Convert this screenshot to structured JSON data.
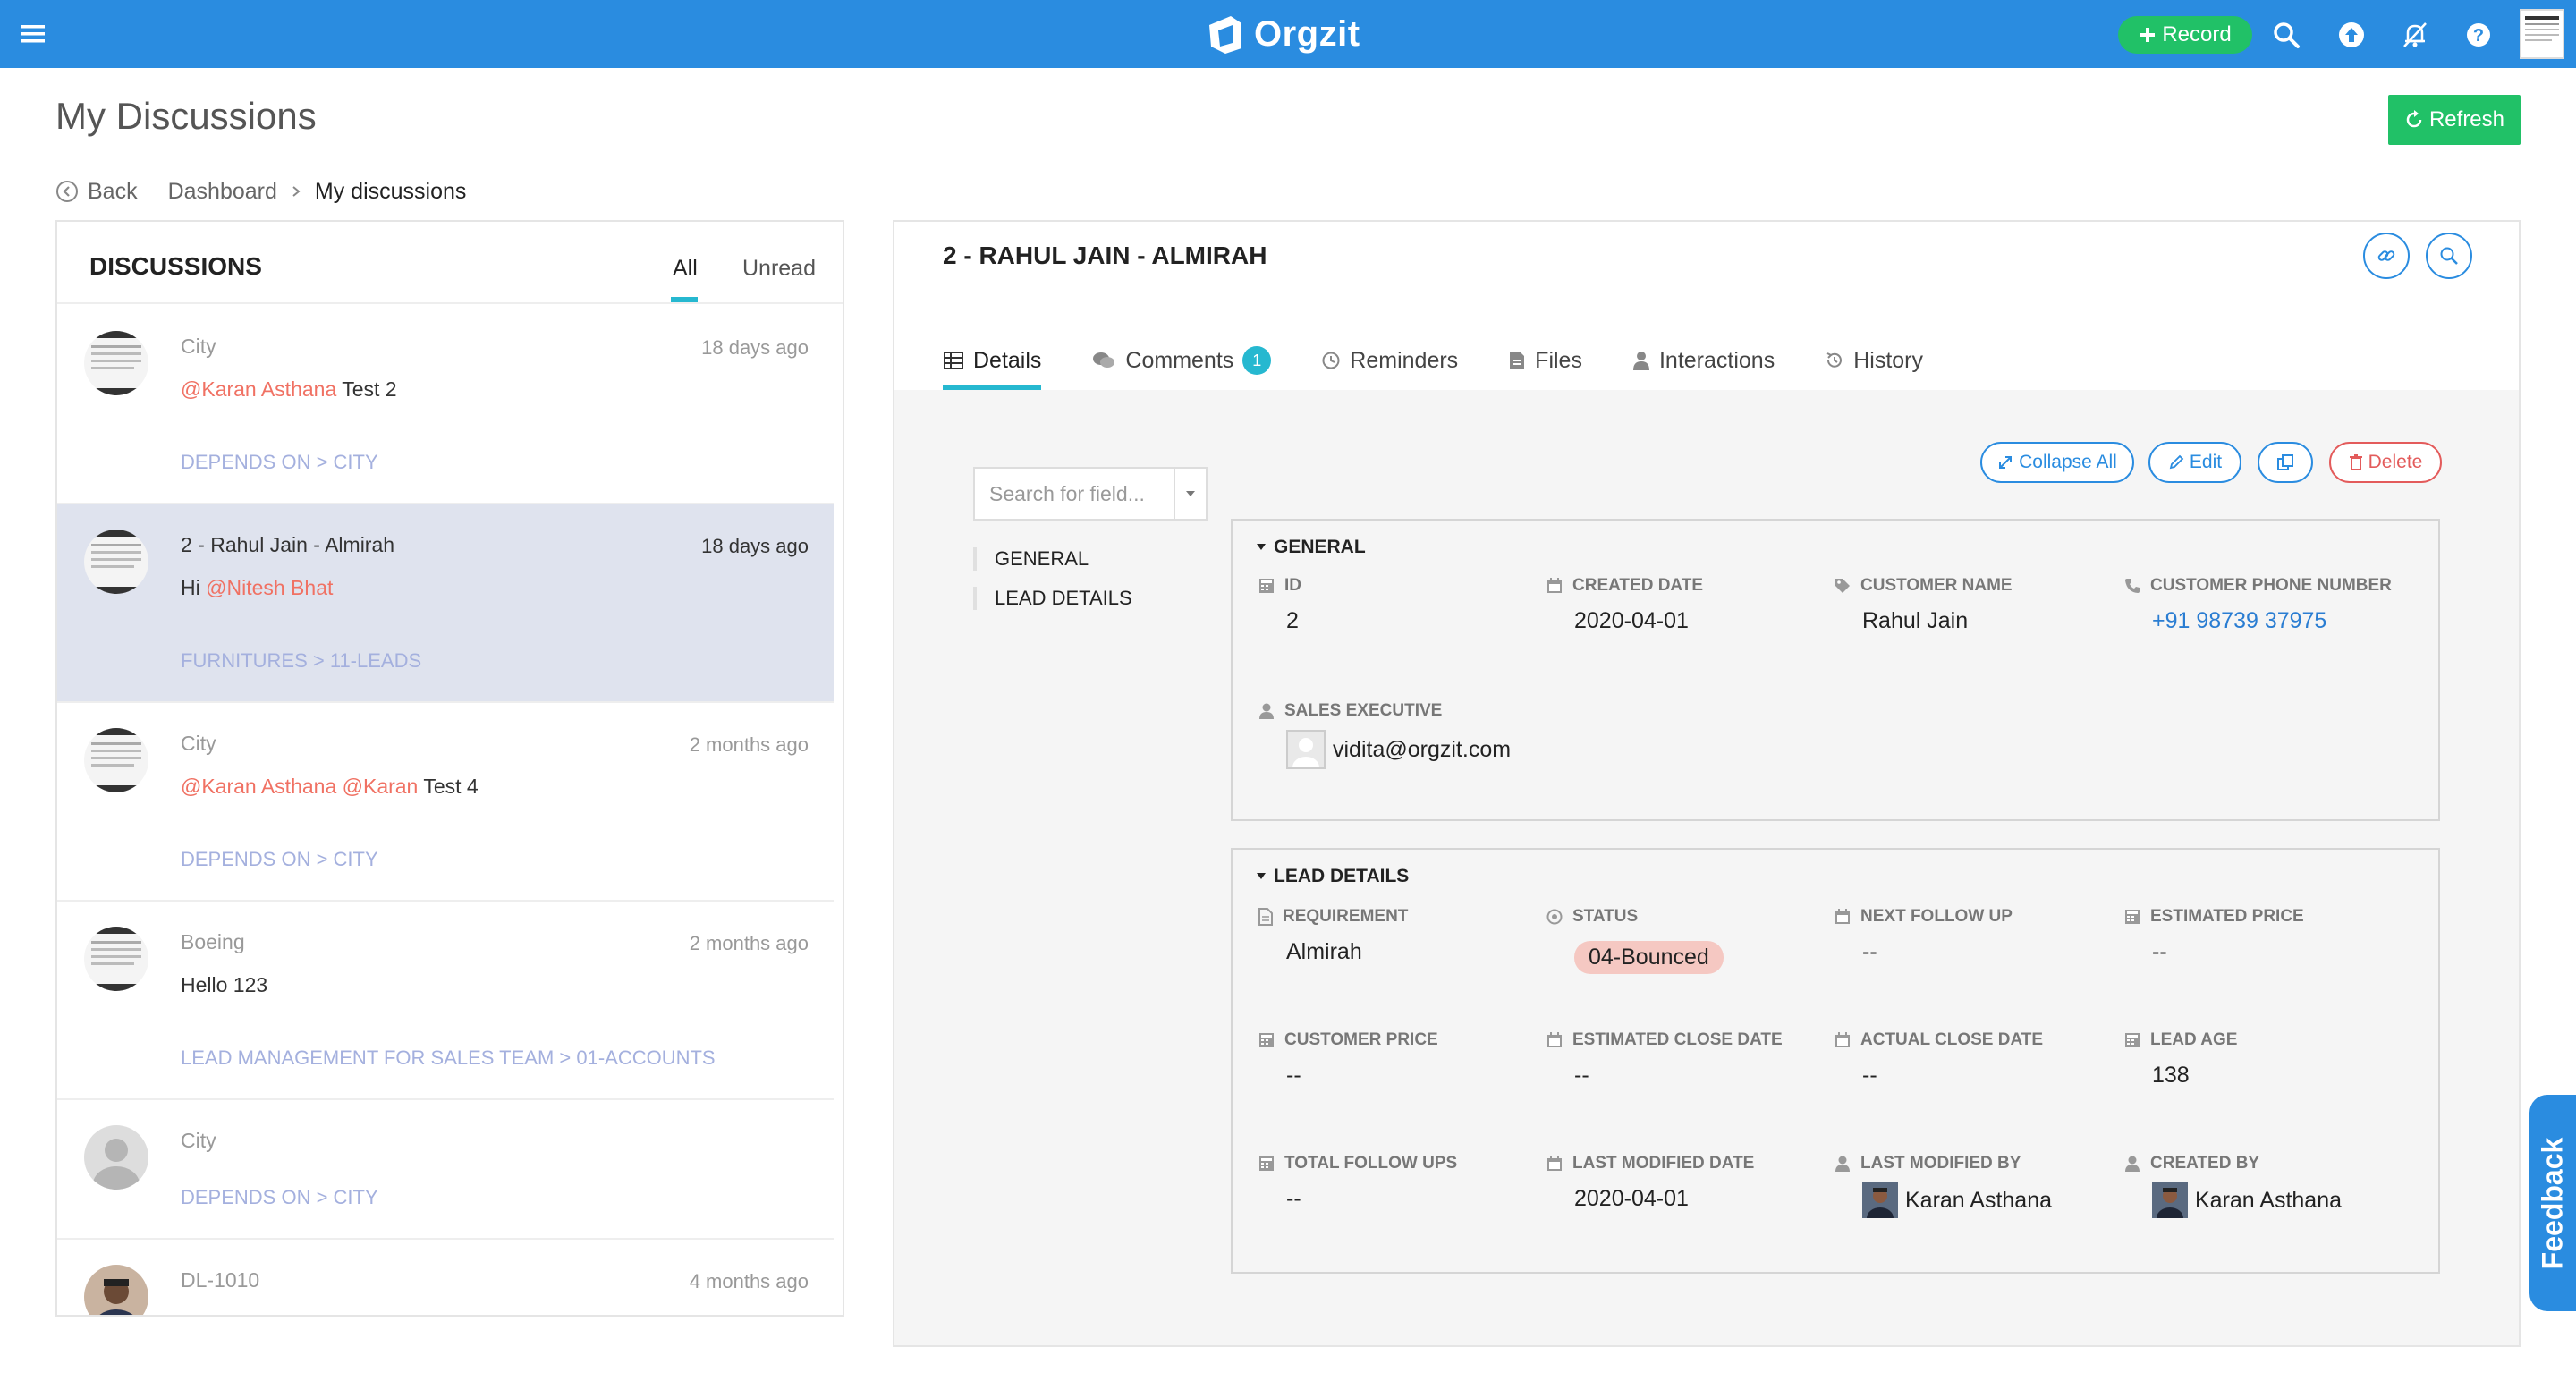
{
  "topbar": {
    "app_name": "Orgzit",
    "record_label": "Record",
    "accent": "#2a8ce0",
    "record_color": "#21c167"
  },
  "page": {
    "title": "My Discussions",
    "refresh_label": "Refresh"
  },
  "breadcrumb": {
    "back": "Back",
    "items": [
      "Dashboard",
      "My discussions"
    ]
  },
  "discussions": {
    "heading": "DISCUSSIONS",
    "tabs": [
      "All",
      "Unread"
    ],
    "active_tab": "All",
    "items": [
      {
        "subject": "City",
        "time": "18 days ago",
        "mentions": "@Karan Asthana",
        "text": " Test 2",
        "path": "DEPENDS ON > CITY",
        "selected": false
      },
      {
        "subject": "2 - Rahul Jain - Almirah",
        "time": "18 days ago",
        "prefix": "Hi ",
        "mentions": "@Nitesh Bhat",
        "text": "",
        "path": "FURNITURES > 11-LEADS",
        "selected": true
      },
      {
        "subject": "City",
        "time": "2 months ago",
        "mentions": "@Karan Asthana @Karan",
        "text": " Test 4",
        "path": "DEPENDS ON > CITY",
        "selected": false
      },
      {
        "subject": "Boeing",
        "time": "2 months ago",
        "text": "Hello 123",
        "path": "LEAD MANAGEMENT FOR SALES TEAM > 01-ACCOUNTS",
        "selected": false
      },
      {
        "subject": "City",
        "time": "",
        "path": "DEPENDS ON > CITY",
        "selected": false
      },
      {
        "subject": "DL-1010",
        "time": "4 months ago",
        "selected": false
      }
    ]
  },
  "record": {
    "title": "2 - RAHUL JAIN - ALMIRAH",
    "tabs": [
      {
        "label": "Details",
        "icon": "table-icon",
        "active": true
      },
      {
        "label": "Comments",
        "icon": "comments-icon",
        "badge": "1"
      },
      {
        "label": "Reminders",
        "icon": "clock-icon"
      },
      {
        "label": "Files",
        "icon": "file-icon"
      },
      {
        "label": "Interactions",
        "icon": "user-icon"
      },
      {
        "label": "History",
        "icon": "history-icon"
      }
    ],
    "search_placeholder": "Search for field...",
    "nav": [
      "GENERAL",
      "LEAD DETAILS"
    ],
    "actions": {
      "collapse": "Collapse All",
      "edit": "Edit",
      "delete": "Delete"
    },
    "general": {
      "title": "GENERAL",
      "fields": {
        "id": {
          "label": "ID",
          "value": "2"
        },
        "created_date": {
          "label": "CREATED DATE",
          "value": "2020-04-01"
        },
        "customer_name": {
          "label": "CUSTOMER NAME",
          "value": "Rahul Jain"
        },
        "customer_phone": {
          "label": "CUSTOMER PHONE NUMBER",
          "value": "+91 98739 37975"
        },
        "sales_executive": {
          "label": "SALES EXECUTIVE",
          "value": "vidita@orgzit.com"
        }
      }
    },
    "lead_details": {
      "title": "LEAD DETAILS",
      "fields": {
        "requirement": {
          "label": "REQUIREMENT",
          "value": "Almirah"
        },
        "status": {
          "label": "STATUS",
          "value": "04-Bounced",
          "color": "#f5c8c2"
        },
        "next_follow_up": {
          "label": "NEXT FOLLOW UP",
          "value": "--"
        },
        "estimated_price": {
          "label": "ESTIMATED PRICE",
          "value": "--"
        },
        "customer_price": {
          "label": "CUSTOMER PRICE",
          "value": "--"
        },
        "estimated_close_date": {
          "label": "ESTIMATED CLOSE DATE",
          "value": "--"
        },
        "actual_close_date": {
          "label": "ACTUAL CLOSE DATE",
          "value": "--"
        },
        "lead_age": {
          "label": "LEAD AGE",
          "value": "138"
        },
        "total_follow_ups": {
          "label": "TOTAL FOLLOW UPS",
          "value": "--"
        },
        "last_modified_date": {
          "label": "LAST MODIFIED DATE",
          "value": "2020-04-01"
        },
        "last_modified_by": {
          "label": "LAST MODIFIED BY",
          "value": "Karan Asthana"
        },
        "created_by": {
          "label": "CREATED BY",
          "value": "Karan Asthana"
        }
      }
    }
  },
  "feedback_label": "Feedback"
}
